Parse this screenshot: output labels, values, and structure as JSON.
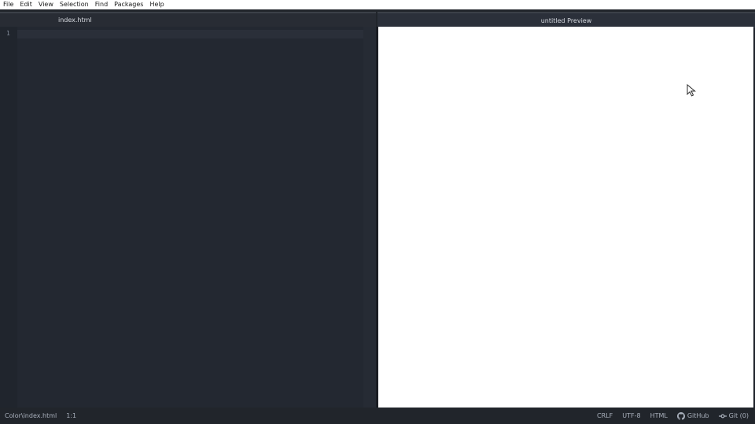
{
  "menu": [
    "File",
    "Edit",
    "View",
    "Selection",
    "Find",
    "Packages",
    "Help"
  ],
  "tabs": {
    "editor": "index.html",
    "preview": "untitled Preview"
  },
  "editor": {
    "line_numbers": [
      "1"
    ]
  },
  "status": {
    "file_path": "Color\\index.html",
    "cursor_position": "1:1",
    "line_ending": "CRLF",
    "encoding": "UTF-8",
    "grammar": "HTML",
    "github": "GitHub",
    "git": "Git (0)"
  },
  "icons": {
    "github": "github-icon",
    "git": "git-commit-icon",
    "cursor": "mouse-pointer-icon"
  },
  "colors": {
    "editor_bg": "#232831",
    "preview_bg": "#ffffff",
    "status_text": "#a9b0bc"
  }
}
